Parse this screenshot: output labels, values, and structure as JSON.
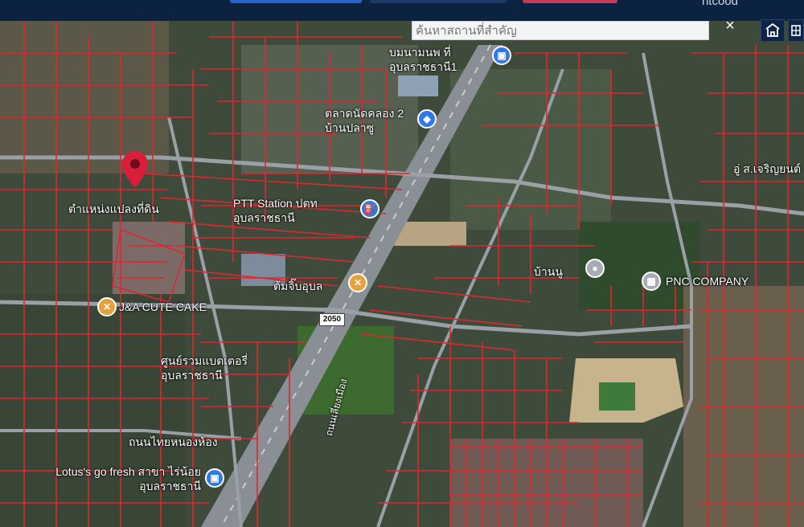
{
  "colors": {
    "topbar": "#0b2340",
    "parcel_lines": "#e0262f",
    "road": "#8a8f96",
    "pin": "#d81e3a",
    "poi_blue": "#2f79e8",
    "poi_orange": "#e8a13a",
    "poi_gray": "#a8adb5"
  },
  "header": {
    "login_label": "ntcood"
  },
  "search": {
    "placeholder": "ค้นหาสถานที่สำคัญ",
    "close_label": "×"
  },
  "map_buttons": [
    {
      "icon": "building-icon"
    },
    {
      "icon": "layers-icon"
    }
  ],
  "road_shield": "2050",
  "pin_label": "ตำแหน่งแปลงที่ดิน",
  "pois": [
    {
      "label": "บมนามนพ ที่ อุบลราชธานี1",
      "icon": "shopping-icon"
    },
    {
      "label": "ตลาดนัดคลอง 2 บ้านปลาซู",
      "icon": "market-icon"
    },
    {
      "label": "PTT Station ปตท อุบลราชธานี",
      "icon": "gas-station-icon"
    },
    {
      "label": "ต้มจิ๊บอุบล",
      "icon": "restaurant-icon"
    },
    {
      "label": "J&A CUTE CAKE",
      "icon": "restaurant-icon"
    },
    {
      "label": "ศูนย์รวมแบตเตอรี่ อุบลราชธานี",
      "icon": "store-icon"
    },
    {
      "label": "ถนนไทยหนองห้อง",
      "icon": ""
    },
    {
      "label": "Lotus's go fresh สาขา ไร่น้อย อุบลราชธานี",
      "icon": "shopping-icon"
    },
    {
      "label": "บ้านนู",
      "icon": "place-icon"
    },
    {
      "label": "PNC COMPANY",
      "icon": "building-icon"
    },
    {
      "label": "อู่ ส.เจริญยนต์",
      "icon": ""
    },
    {
      "label": "ถนนเลี่ยงเมือง",
      "icon": ""
    }
  ]
}
